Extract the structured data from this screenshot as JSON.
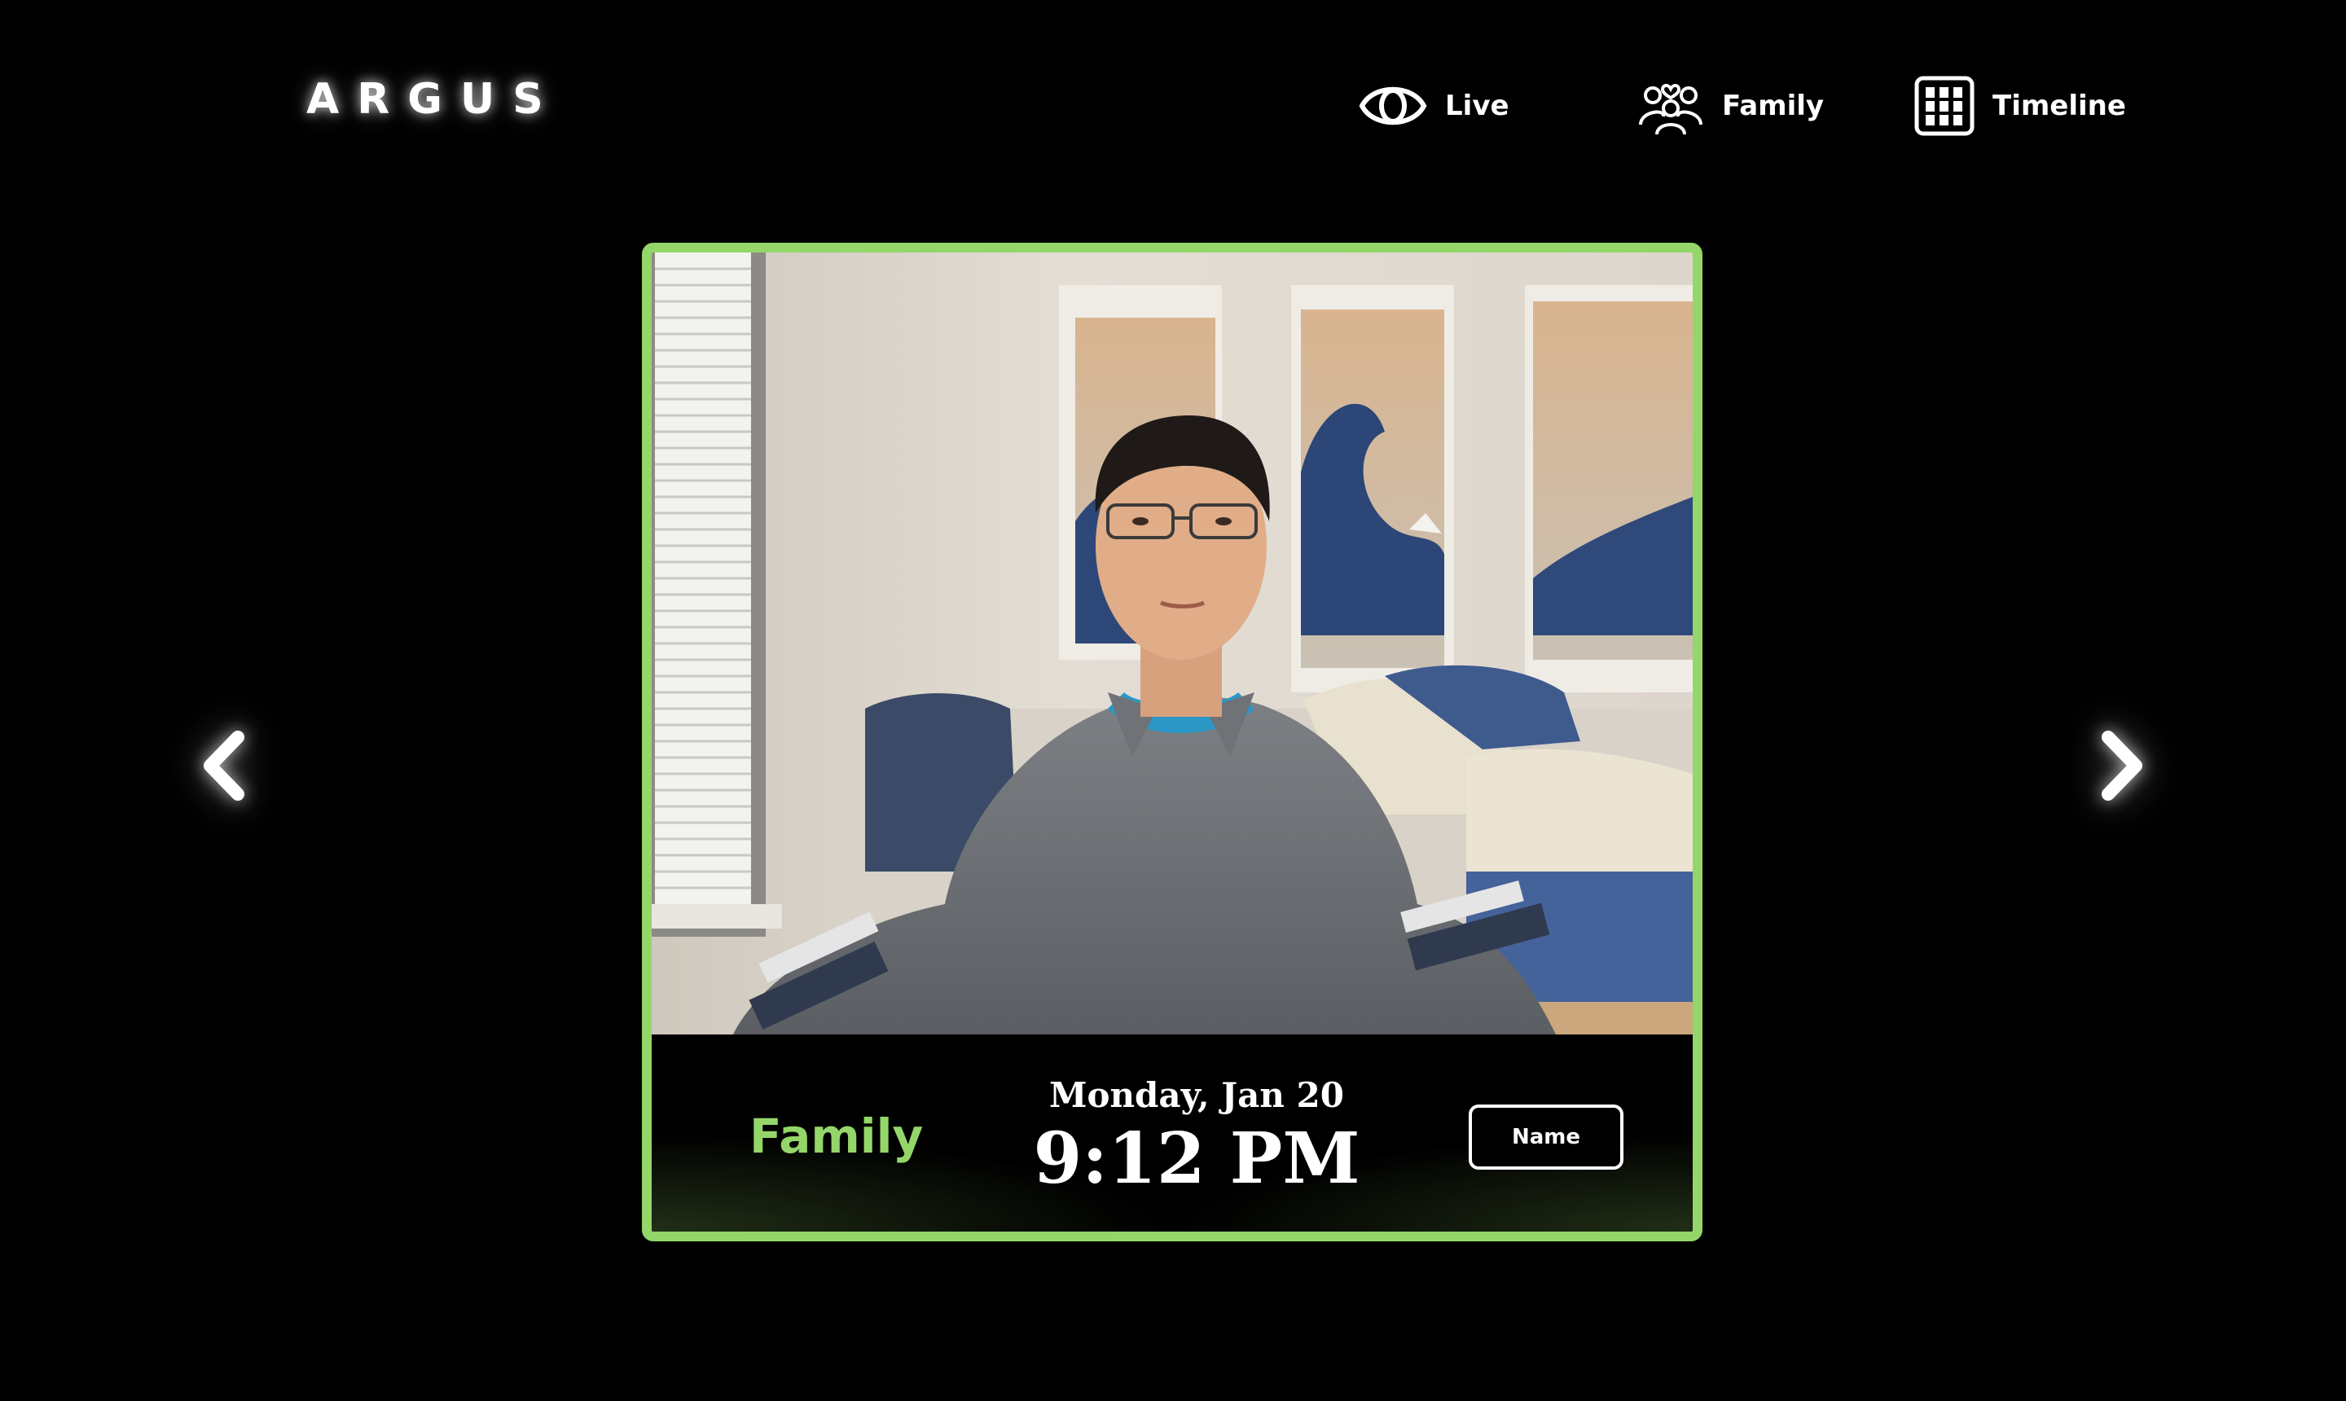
{
  "app": {
    "logo": "ARGUS"
  },
  "nav": {
    "items": [
      {
        "label": "Live",
        "icon": "eye-icon"
      },
      {
        "label": "Family",
        "icon": "family-icon"
      },
      {
        "label": "Timeline",
        "icon": "grid-icon"
      }
    ]
  },
  "carousel": {
    "prev_icon": "chevron-left-icon",
    "next_icon": "chevron-right-icon"
  },
  "card": {
    "category": "Family",
    "date": "Monday, Jan 20",
    "time": "9:12 PM",
    "name_button": "Name",
    "accent_color": "#94d669"
  }
}
